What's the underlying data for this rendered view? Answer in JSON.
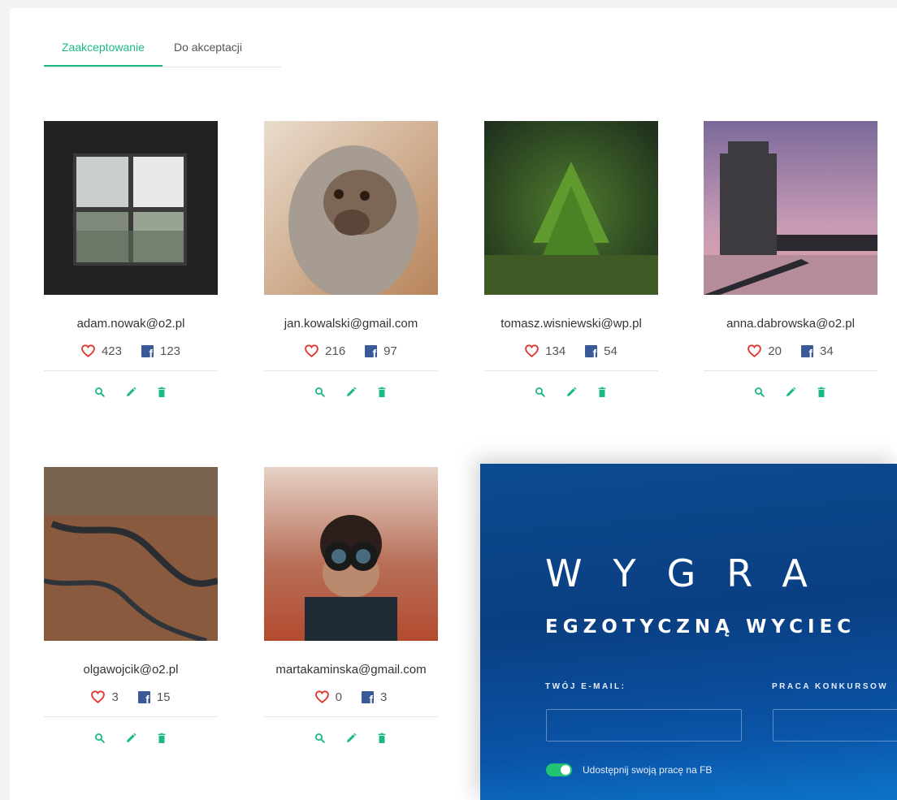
{
  "tabs": [
    {
      "label": "Zaakceptowanie",
      "active": true
    },
    {
      "label": "Do akceptacji",
      "active": false
    }
  ],
  "colors": {
    "accent": "#1db887",
    "heart": "#e0352f",
    "facebook": "#3b5998",
    "promo_blue": "#0a3f82",
    "toggle_on": "#22c474"
  },
  "cards": [
    {
      "email": "adam.nowak@o2.pl",
      "likes": "423",
      "fb": "123",
      "image": "window-photo"
    },
    {
      "email": "jan.kowalski@gmail.com",
      "likes": "216",
      "fb": "97",
      "image": "monkey-photo"
    },
    {
      "email": "tomasz.wisniewski@wp.pl",
      "likes": "134",
      "fb": "54",
      "image": "plant-photo"
    },
    {
      "email": "anna.dabrowska@o2.pl",
      "likes": "20",
      "fb": "34",
      "image": "tower-photo"
    },
    {
      "email": "olgawojcik@o2.pl",
      "likes": "3",
      "fb": "15",
      "image": "canyon-photo"
    },
    {
      "email": "martakaminska@gmail.com",
      "likes": "0",
      "fb": "3",
      "image": "binoculars-photo"
    }
  ],
  "actions": {
    "icons": [
      "search-icon",
      "pencil-icon",
      "trash-icon"
    ]
  },
  "promo": {
    "headline": "WYGRA",
    "subheadline": "EGZOTYCZNĄ WYCIEC",
    "email_label": "TWÓJ E-MAIL:",
    "work_label": "PRACA KONKURSOW",
    "share_label": "Udostępnij swoją pracę na FB",
    "share_enabled": true
  }
}
